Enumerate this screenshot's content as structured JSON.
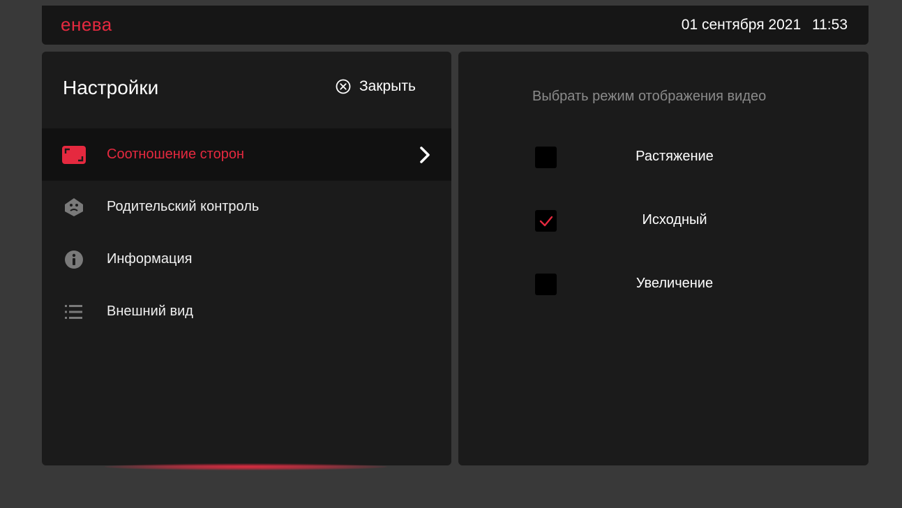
{
  "topbar": {
    "logo": "енева",
    "date": "01 сентября 2021",
    "time": "11:53"
  },
  "settings": {
    "title": "Настройки",
    "close_label": "Закрыть",
    "menu": [
      {
        "label": "Соотношение сторон",
        "icon": "aspect-ratio-icon",
        "active": true
      },
      {
        "label": "Родительский контроль",
        "icon": "parental-control-icon",
        "active": false
      },
      {
        "label": "Информация",
        "icon": "info-icon",
        "active": false
      },
      {
        "label": "Внешний вид",
        "icon": "list-icon",
        "active": false
      }
    ]
  },
  "video_mode": {
    "title": "Выбрать режим отображения видео",
    "options": [
      {
        "label": "Растяжение",
        "checked": false
      },
      {
        "label": "Исходный",
        "checked": true
      },
      {
        "label": "Увеличение",
        "checked": false
      }
    ]
  },
  "colors": {
    "accent": "#e5293f",
    "panel": "#1b1b1b",
    "background": "#393939",
    "active_row": "#111111",
    "muted_text": "#8b8b8b"
  }
}
